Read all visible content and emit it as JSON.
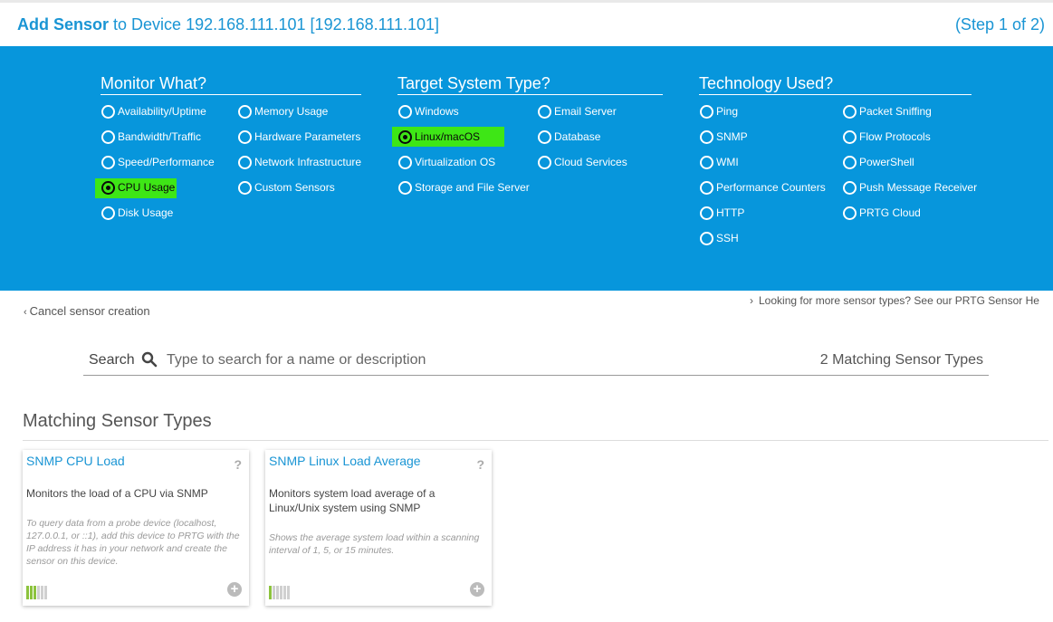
{
  "header": {
    "title_bold": "Add Sensor",
    "title_rest": "to Device",
    "device": "192.168.111.101 [192.168.111.101]",
    "step": "(Step 1 of 2)"
  },
  "monitor_what": {
    "title": "Monitor What?",
    "options": [
      {
        "label": "Availability/Uptime",
        "selected": false
      },
      {
        "label": "Bandwidth/Traffic",
        "selected": false
      },
      {
        "label": "Speed/Performance",
        "selected": false
      },
      {
        "label": "CPU Usage",
        "selected": true
      },
      {
        "label": "Disk Usage",
        "selected": false
      },
      {
        "label": "Memory Usage",
        "selected": false
      },
      {
        "label": "Hardware Parameters",
        "selected": false
      },
      {
        "label": "Network Infrastructure",
        "selected": false
      },
      {
        "label": "Custom Sensors",
        "selected": false
      }
    ]
  },
  "target_system": {
    "title": "Target System Type?",
    "options": [
      {
        "label": "Windows",
        "selected": false
      },
      {
        "label": "Linux/macOS",
        "selected": true
      },
      {
        "label": "Virtualization OS",
        "selected": false
      },
      {
        "label": "Storage and File Server",
        "selected": false
      },
      {
        "label": "Email Server",
        "selected": false
      },
      {
        "label": "Database",
        "selected": false
      },
      {
        "label": "Cloud Services",
        "selected": false
      }
    ]
  },
  "technology": {
    "title": "Technology Used?",
    "options": [
      {
        "label": "Ping",
        "selected": false
      },
      {
        "label": "SNMP",
        "selected": false
      },
      {
        "label": "WMI",
        "selected": false
      },
      {
        "label": "Performance Counters",
        "selected": false
      },
      {
        "label": "HTTP",
        "selected": false
      },
      {
        "label": "SSH",
        "selected": false
      },
      {
        "label": "Packet Sniffing",
        "selected": false
      },
      {
        "label": "Flow Protocols",
        "selected": false
      },
      {
        "label": "PowerShell",
        "selected": false
      },
      {
        "label": "Push Message Receiver",
        "selected": false
      },
      {
        "label": "PRTG Cloud",
        "selected": false
      }
    ]
  },
  "links": {
    "cancel": "Cancel sensor creation",
    "more": "Looking for more sensor types? See our PRTG Sensor He"
  },
  "search": {
    "label": "Search",
    "placeholder": "Type to search for a name or description",
    "count": "2",
    "count_label": "Matching Sensor Types"
  },
  "results": {
    "title": "Matching Sensor Types",
    "cards": [
      {
        "title": "SNMP CPU Load",
        "help": "?",
        "description": "Monitors the load of a CPU via SNMP",
        "note": "To query data from a probe device (localhost, 127.0.0.1, or ::1), add this device to PRTG with the IP address it has in your network and create the sensor on this device.",
        "performance_level": 0.5
      },
      {
        "title": "SNMP Linux Load Average",
        "help": "?",
        "description": "Monitors system load average of a Linux/Unix system using SNMP",
        "note": "Shows the average system load within a scanning interval of 1, 5, or 15 minutes.",
        "performance_level": 0.17
      }
    ]
  },
  "colors": {
    "accent": "#1a95d4",
    "panel": "#0796dc",
    "highlight": "#3ee616",
    "perf_bar_on": "#8cc33d"
  }
}
